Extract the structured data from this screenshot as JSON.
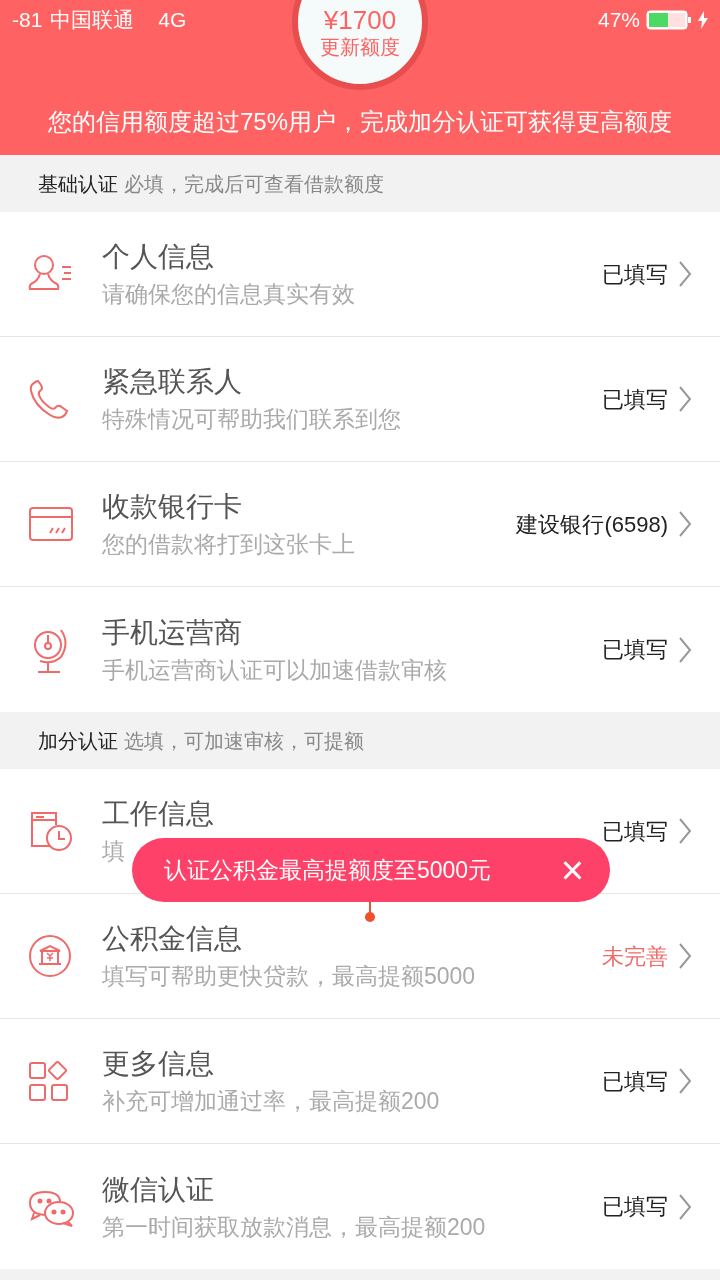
{
  "status_bar": {
    "signal": "-81",
    "carrier": "中国联通",
    "network": "4G",
    "battery": "47%"
  },
  "credit": {
    "amount": "¥1700",
    "action": "更新额度"
  },
  "banner": "您的信用额度超过75%用户，完成加分认证可获得更高额度",
  "sections": [
    {
      "title": "基础认证",
      "note": "必填，完成后可查看借款额度",
      "items": [
        {
          "title": "个人信息",
          "subtitle": "请确保您的信息真实有效",
          "status": "已填写",
          "incomplete": false
        },
        {
          "title": "紧急联系人",
          "subtitle": "特殊情况可帮助我们联系到您",
          "status": "已填写",
          "incomplete": false
        },
        {
          "title": "收款银行卡",
          "subtitle": "您的借款将打到这张卡上",
          "status": "建设银行(6598)",
          "incomplete": false
        },
        {
          "title": "手机运营商",
          "subtitle": "手机运营商认证可以加速借款审核",
          "status": "已填写",
          "incomplete": false
        }
      ]
    },
    {
      "title": "加分认证",
      "note": "选填，可加速审核，可提额",
      "items": [
        {
          "title": "工作信息",
          "subtitle": "填",
          "status": "已填写",
          "incomplete": false
        },
        {
          "title": "公积金信息",
          "subtitle": "填写可帮助更快贷款，最高提额5000",
          "status": "未完善",
          "incomplete": true
        },
        {
          "title": "更多信息",
          "subtitle": "补充可增加通过率，最高提额200",
          "status": "已填写",
          "incomplete": false
        },
        {
          "title": "微信认证",
          "subtitle": "第一时间获取放款消息，最高提额200",
          "status": "已填写",
          "incomplete": false
        }
      ]
    }
  ],
  "tooltip": {
    "text": "认证公积金最高提额度至5000元",
    "close": "×"
  }
}
